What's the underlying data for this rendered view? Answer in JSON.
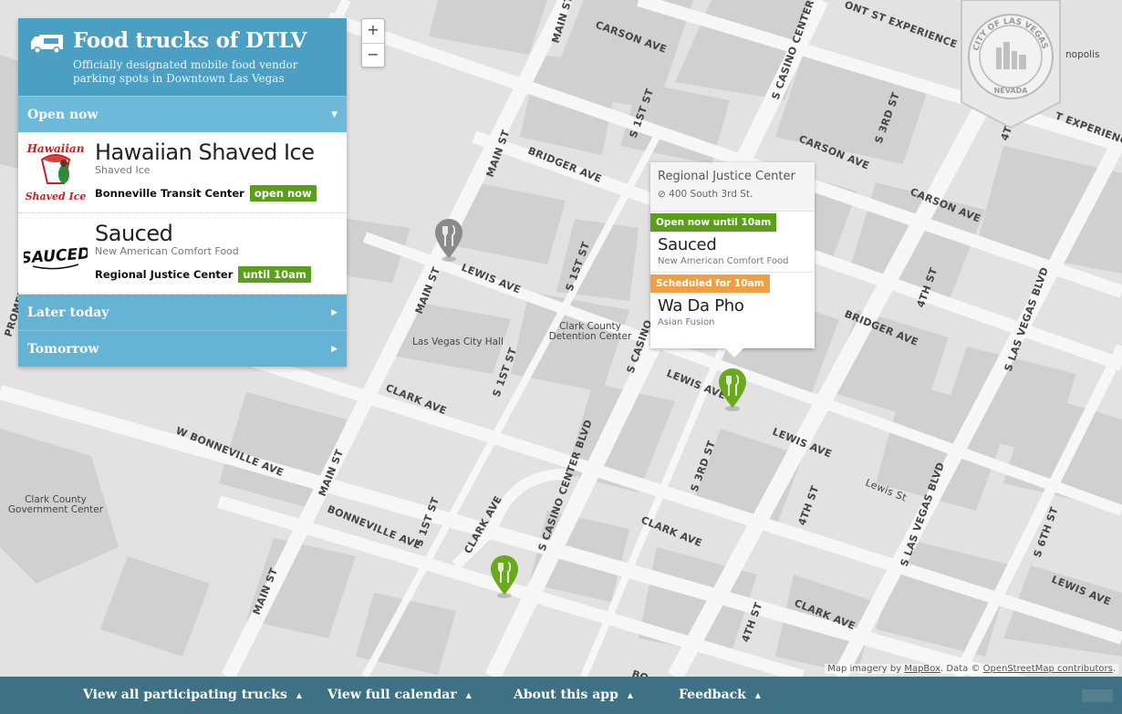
{
  "panel": {
    "title": "Food trucks of DTLV",
    "subtitle": "Officially designated mobile food vendor parking spots in Downtown Las Vegas",
    "sections": {
      "open_now": "Open now",
      "later_today": "Later today",
      "tomorrow": "Tomorrow"
    },
    "trucks": [
      {
        "name": "Hawaiian Shaved Ice",
        "category": "Shaved Ice",
        "location": "Bonneville Transit Center",
        "badge": "open now",
        "badge_color": "#5a9e1a"
      },
      {
        "name": "Sauced",
        "category": "New American Comfort Food",
        "location": "Regional Justice Center",
        "badge": "until 10am",
        "badge_color": "#5a9e1a"
      }
    ]
  },
  "zoom": {
    "in": "+",
    "out": "−"
  },
  "popup": {
    "title": "Regional Justice Center",
    "address": "400 South 3rd St.",
    "entries": [
      {
        "status": "Open now until 10am",
        "status_color": "#5a9e1a",
        "name": "Sauced",
        "category": "New American Comfort Food"
      },
      {
        "status": "Scheduled for 10am",
        "status_color": "#f0a042",
        "name": "Wa Da Pho",
        "category": "Asian Fusion"
      }
    ]
  },
  "map": {
    "streets": {
      "main_st": "MAIN ST",
      "carson_ave": "CARSON AVE",
      "bridger_ave": "BRIDGER AVE",
      "lewis_ave": "LEWIS AVE",
      "clark_ave": "CLARK AVE",
      "bonneville_ave": "BONNEVILLE AVE",
      "w_bonneville_ave": "W BONNEVILLE AVE",
      "s_1st_st": "S 1ST ST",
      "s_3rd_st": "S 3RD ST",
      "s_casino_center_blvd": "S CASINO CENTER BLVD",
      "s_casino": "S CASINO",
      "fourth_st": "4TH ST",
      "s_las_vegas_blvd": "S LAS VEGAS BLVD",
      "s_6th_st": "S 6TH ST",
      "lewis_st": "Lewis St",
      "fremont": "ONT ST EXPERIENCE",
      "fremont2": "T EXPERIENCE",
      "promen": "PROMEN",
      "clark_ave_short": "CLARK AVE",
      "bo": "BO"
    },
    "places": {
      "city_hall": "Las Vegas City Hall",
      "detention_1": "Clark County",
      "detention_2": "Detention Center",
      "gov_1": "Clark County",
      "gov_2": "Government Center",
      "nopolis": "nopolis"
    },
    "seal_text": "CITY OF LAS VEGAS",
    "seal_bottom": "NEVADA",
    "colors": {
      "green_marker": "#6aa81e",
      "gray_marker": "#8a8a8a",
      "accent": "#4a9fc3"
    }
  },
  "attribution": {
    "prefix": "Map imagery by ",
    "mapbox": "MapBox",
    "mid": ". Data © ",
    "osm": "OpenStreetMap contributors",
    "suffix": "."
  },
  "footer": {
    "links": [
      "View all participating trucks",
      "View full calendar",
      "About this app",
      "Feedback"
    ]
  }
}
